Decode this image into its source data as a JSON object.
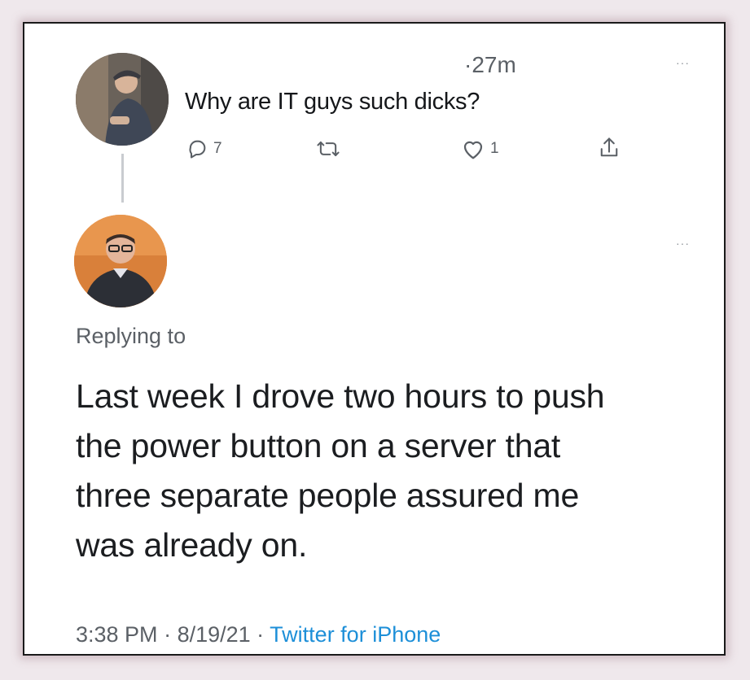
{
  "parent_tweet": {
    "time": "·27m",
    "text": "Why are IT guys such dicks?",
    "more": "···",
    "actions": {
      "reply_count": "7",
      "retweet_count": "",
      "like_count": "1"
    }
  },
  "reply_tweet": {
    "more": "···",
    "replying_to": "Replying to",
    "lines": [
      "Last week I drove two hours to push",
      "the power button on a server that",
      "three separate people assured me",
      "was already on."
    ],
    "footer": {
      "time": "3:38 PM",
      "sep1": " · ",
      "date": "8/19/21",
      "sep2": " · ",
      "source": "Twitter for iPhone"
    }
  },
  "icons": {
    "reply": "speech-bubble-icon",
    "retweet": "retweet-icon",
    "like": "heart-icon",
    "share": "share-icon"
  },
  "colors": {
    "text": "#15171a",
    "muted": "#5b6066",
    "link": "#1d8fd8",
    "thread_line": "#c9ccd0"
  }
}
